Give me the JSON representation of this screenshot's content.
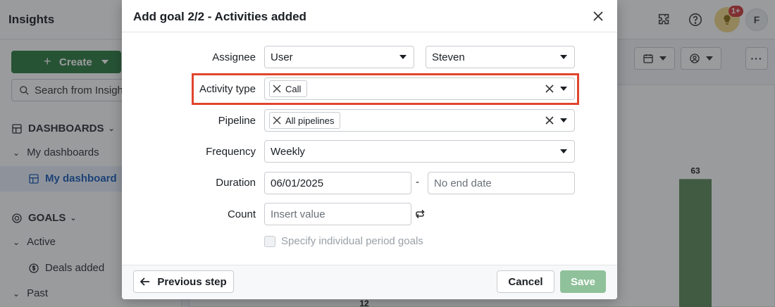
{
  "app": {
    "title": "Insights",
    "badge_count": "1+",
    "avatar_initial": "F"
  },
  "sidebar": {
    "create_label": "Create",
    "search_placeholder": "Search from Insights",
    "dashboards_heading": "DASHBOARDS",
    "my_dashboards": "My dashboards",
    "my_dashboard": "My dashboard",
    "goals_heading": "GOALS",
    "active": "Active",
    "deals_added": "Deals added",
    "past": "Past"
  },
  "chart_data": {
    "type": "bar",
    "visible_data_labels": [
      {
        "label": "63",
        "value": 63
      },
      {
        "label": "12",
        "value": 12
      }
    ]
  },
  "modal": {
    "title": "Add goal 2/2 - Activities added",
    "assignee": {
      "label": "Assignee",
      "type_value": "User",
      "person_value": "Steven"
    },
    "activity_type": {
      "label": "Activity type",
      "chip": "Call"
    },
    "pipeline": {
      "label": "Pipeline",
      "chip": "All pipelines"
    },
    "frequency": {
      "label": "Frequency",
      "value": "Weekly"
    },
    "duration": {
      "label": "Duration",
      "start": "06/01/2025",
      "separator": "-",
      "end_placeholder": "No end date"
    },
    "count": {
      "label": "Count",
      "placeholder": "Insert value"
    },
    "specify_period_goals": "Specify individual period goals",
    "footer": {
      "previous": "Previous step",
      "cancel": "Cancel",
      "save": "Save"
    }
  },
  "colors": {
    "primary_green": "#2e7d43",
    "save_disabled": "#8fc19a",
    "highlight": "#e0452e",
    "bar": "#5e8a5c"
  }
}
